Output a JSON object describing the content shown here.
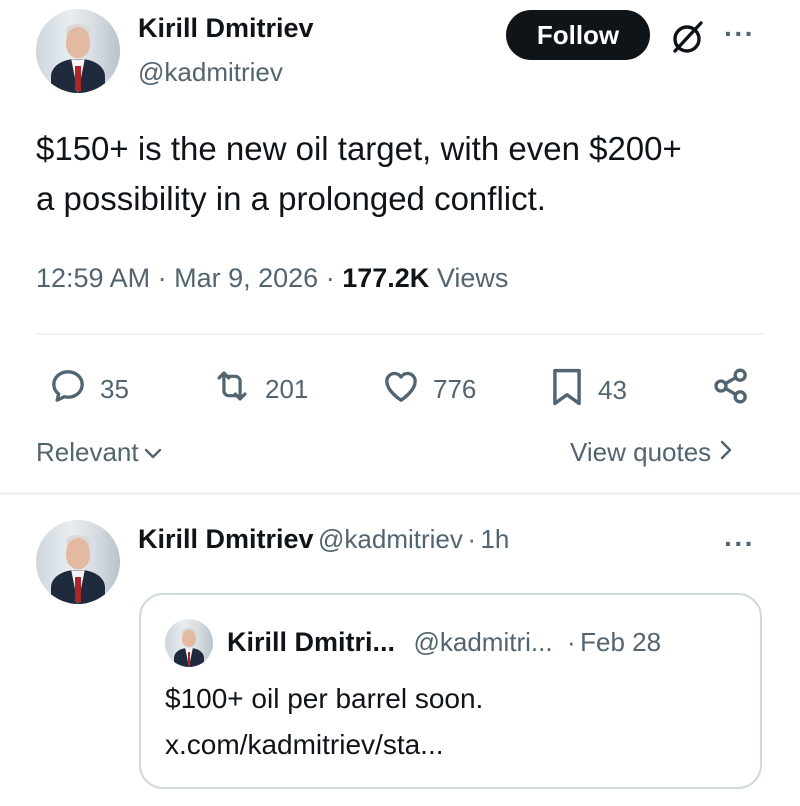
{
  "main_tweet": {
    "author_name": "Kirill Dmitriev",
    "author_handle": "@kadmitriev",
    "follow_label": "Follow",
    "more_label": "···",
    "text_line1": "$150+ is the new oil target, with even $200+",
    "text_line2": "a possibility in a prolonged conflict.",
    "time": "12:59 AM",
    "sep": "·",
    "date": "Mar 9, 2026",
    "views_count": "177.2K",
    "views_label": "Views",
    "actions": {
      "replies": "35",
      "retweets": "201",
      "likes": "776",
      "bookmarks": "43"
    }
  },
  "sort": {
    "label": "Relevant",
    "view_quotes": "View quotes"
  },
  "reply": {
    "author_name": "Kirill Dmitriev",
    "author_handle": "@kadmitriev",
    "sep": "·",
    "time": "1h",
    "more_label": "···",
    "quote": {
      "author_name": "Kirill Dmitri...",
      "author_handle": "@kadmitri...",
      "sep": "·",
      "date": "Feb 28",
      "text": "$100+ oil per barrel soon.",
      "link": "x.com/kadmitriev/sta..."
    }
  },
  "colors": {
    "text": "#0f1419",
    "secondary": "#536471",
    "divider": "#eff3f4",
    "button_bg": "#0f1419"
  }
}
